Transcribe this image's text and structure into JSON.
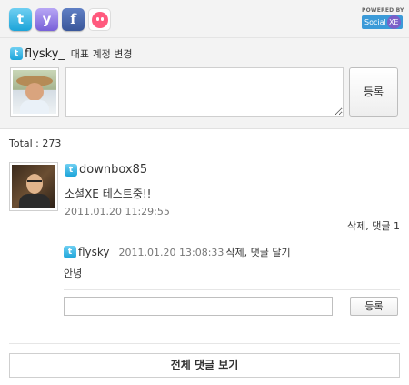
{
  "services": {
    "twitter_glyph": "t",
    "yozm_glyph": "y",
    "facebook_glyph": "f",
    "colors": {
      "twitter": "#1ca4d9",
      "yozm": "#7860d8",
      "facebook": "#3a579a",
      "me2day": "#ff5a7e"
    }
  },
  "powered_by": {
    "label": "POWERED BY",
    "logo_text": "Social",
    "logo_badge": "XE"
  },
  "account": {
    "name": "flysky_",
    "change_label": "대표 계정 변경"
  },
  "compose": {
    "value": "",
    "submit_label": "등록"
  },
  "total": "Total : 273",
  "comments": [
    {
      "author": "downbox85",
      "text": "소셜XE 테스트중!!",
      "date": "2011.01.20 11:29:55",
      "actions": "삭제, 댓글 1",
      "replies": [
        {
          "author": "flysky_",
          "date": "2011.01.20 13:08:33",
          "actions": "삭제, 댓글 달기",
          "text": "안녕"
        }
      ]
    }
  ],
  "reply_form": {
    "value": "",
    "submit_label": "등록"
  },
  "view_all_label": "전체 댓글 보기"
}
